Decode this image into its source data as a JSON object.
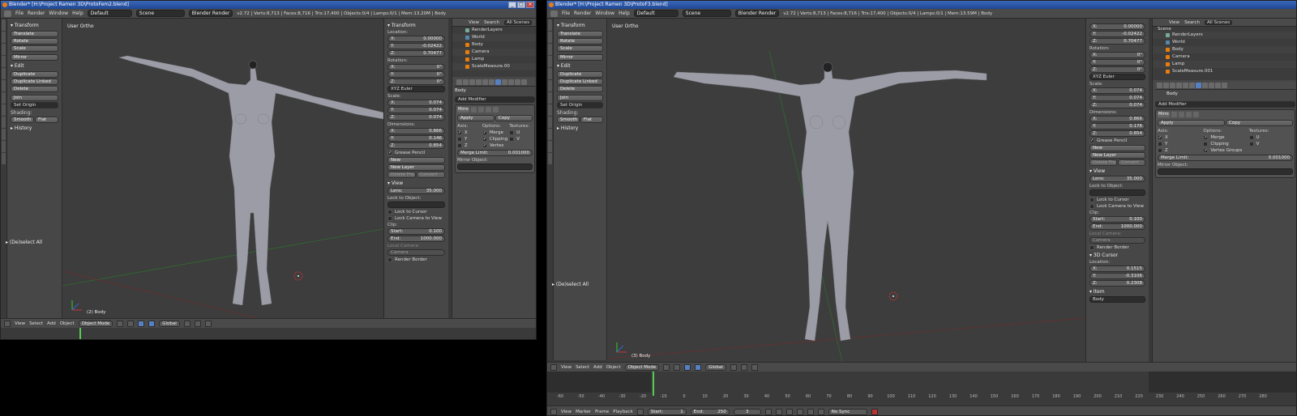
{
  "left": {
    "title": "Blender* [H:\\Project Ramen 3D\\ProtoFem2.blend]",
    "menu": [
      "File",
      "Render",
      "Window",
      "Help"
    ],
    "layout": "Default",
    "scene": "Scene",
    "engine": "Blender Render",
    "stats": "v2.72 | Verts:8,713 | Faces:8,716 | Tris:17,400 | Objects:0/4 | Lamps:0/1 | Mem:13.20M | Body",
    "viewport_label": "User Ortho",
    "object_label": "(2) Body",
    "props": {
      "location": [
        "X:",
        "0.00000",
        "Y:",
        "-0.02422",
        "Z:",
        "0.70477"
      ],
      "rotation": [
        "X:",
        "0°",
        "Y:",
        "0°",
        "Z:",
        "0°"
      ],
      "rotation_mode": "XYZ Euler",
      "scale": [
        "X:",
        "0.074",
        "Y:",
        "0.074",
        "Z:",
        "0.074"
      ],
      "dimensions": [
        "X:",
        "0.866",
        "Y:",
        "0.146",
        "Z:",
        "0.854"
      ],
      "lens": "35.000",
      "clip_start": "0.100",
      "clip_end": "1000.000"
    },
    "outliner": {
      "items": [
        "RenderLayers",
        "World",
        "Body",
        "Camera",
        "Lamp",
        "ScaleMeasure.00"
      ]
    },
    "footer": [
      "View",
      "Select",
      "Add",
      "Object"
    ],
    "mode": "Object Mode",
    "orientation": "Global"
  },
  "right": {
    "title": "Blender* [H:\\Project Ramen 3D\\ProtoF3.blend]",
    "menu": [
      "File",
      "Render",
      "Window",
      "Help"
    ],
    "layout": "Default",
    "scene": "Scene",
    "engine": "Blender Render",
    "stats": "v2.72 | Verts:8,713 | Faces:8,716 | Tris:17,400 | Objects:0/4 | Lamps:0/1 | Mem:13.59M | Body",
    "viewport_label": "User Ortho",
    "object_label": "(3) Body",
    "props": {
      "location": [
        "X:",
        "0.00000",
        "Y:",
        "-0.02422",
        "Z:",
        "0.70477"
      ],
      "rotation": [
        "X:",
        "0°",
        "Y:",
        "0°",
        "Z:",
        "0°"
      ],
      "rotation_mode": "XYZ Euler",
      "scale": [
        "X:",
        "0.074",
        "Y:",
        "0.074",
        "Z:",
        "0.074"
      ],
      "dimensions": [
        "X:",
        "0.866",
        "Y:",
        "0.176",
        "Z:",
        "0.854"
      ],
      "lens": "35.000",
      "clip_start": "0.100",
      "clip_end": "1000.000",
      "cursor": [
        "X:",
        "0.1515",
        "Y:",
        "-0.3106",
        "Z:",
        "0.2308"
      ]
    },
    "outliner": {
      "items": [
        "Scene",
        "RenderLayers",
        "World",
        "Body",
        "Camera",
        "Lamp",
        "ScaleMeasure.001"
      ]
    },
    "footer": [
      "View",
      "Select",
      "Add",
      "Object"
    ],
    "mode": "Object Mode",
    "orientation": "Global",
    "timeline": {
      "menu": [
        "View",
        "Marker",
        "Frame",
        "Playback"
      ],
      "start": "Start:",
      "start_val": "1",
      "end": "End:",
      "end_val": "250",
      "current": "3",
      "sync": "No Sync",
      "ticks": [
        "-60",
        "-50",
        "-40",
        "-30",
        "-20",
        "-10",
        "0",
        "10",
        "20",
        "30",
        "40",
        "50",
        "60",
        "70",
        "80",
        "90",
        "100",
        "110",
        "120",
        "130",
        "140",
        "150",
        "160",
        "170",
        "180",
        "190",
        "200",
        "210",
        "220",
        "230",
        "240",
        "250",
        "260",
        "270",
        "280"
      ]
    }
  },
  "shared": {
    "tool_headers": {
      "transform": "Transform",
      "edit": "Edit",
      "history": "History"
    },
    "tools": {
      "translate": "Translate",
      "rotate": "Rotate",
      "scale": "Scale",
      "mirror": "Mirror",
      "duplicate": "Duplicate",
      "duplicate_linked": "Duplicate Linked",
      "delete": "Delete",
      "join": "Join",
      "set_origin": "Set Origin",
      "shading": "Shading:",
      "smooth": "Smooth",
      "flat": "Flat"
    },
    "deselect_all": "(De)select All",
    "prop_labels": {
      "transform": "Transform",
      "location": "Location:",
      "rotation": "Rotation:",
      "scale": "Scale:",
      "dimensions": "Dimensions:",
      "grease": "Grease Pencil",
      "new": "New",
      "new_layer": "New Layer",
      "delete_frame": "Delete Fra...",
      "convert": "Convert",
      "view": "View",
      "lens": "Lens:",
      "lock_object": "Lock to Object:",
      "lock_cursor": "Lock to Cursor",
      "lock_camera": "Lock Camera to View",
      "clip": "Clip:",
      "start": "Start:",
      "end": "End:",
      "local_camera": "Local Camera:",
      "camera": "Camera",
      "render_border": "Render Border",
      "cursor3d": "3D Cursor",
      "cursor_location": "Location:",
      "item": "Item",
      "body": "Body"
    },
    "outliner_hdr": {
      "view": "View",
      "search": "Search",
      "scenes": "All Scenes"
    },
    "modifier": {
      "object": "Body",
      "add": "Add Modifier",
      "name": "Mirro",
      "apply": "Apply",
      "copy": "Copy",
      "axis": "Axis:",
      "options": "Options:",
      "textures": "Textures:",
      "x": "X",
      "y": "Y",
      "z": "Z",
      "merge": "Merge",
      "clipping": "Clipping",
      "vertex": "Vertex",
      "vertex_groups": "Vertex Groups",
      "u": "U",
      "v": "V",
      "merge_limit": "Merge Limit:",
      "merge_limit_val": "0.001000",
      "mirror_object": "Mirror Object:"
    }
  }
}
